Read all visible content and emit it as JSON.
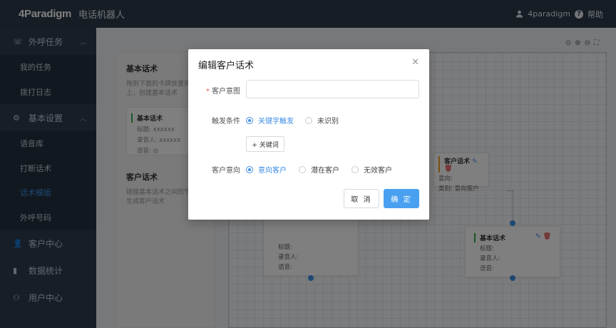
{
  "header": {
    "logo_prefix": "4",
    "logo_text": "Paradigm",
    "app_title": "电话机器人",
    "user_icon": "user-icon",
    "username": "4paradigm",
    "help_icon": "help-circle-icon",
    "help_label": "帮助"
  },
  "sidebar": {
    "groups": [
      {
        "label": "外呼任务",
        "icon": "phone-icon"
      },
      {
        "label": "基本设置",
        "icon": "gear-icon"
      },
      {
        "label": "客户中心",
        "icon": "user-icon"
      },
      {
        "label": "数据统计",
        "icon": "bar-chart-icon"
      },
      {
        "label": "用户中心",
        "icon": "user-outline-icon"
      }
    ],
    "task_items": [
      "我的任务",
      "拨打日志"
    ],
    "settings_items": [
      "语音库",
      "打断话术",
      "话术模版",
      "外呼号码"
    ],
    "active_item": "话术模版"
  },
  "left_panel": {
    "basic_title": "基本话术",
    "basic_desc": "拖到下面的卡牌放置到画布上，创建基本话术",
    "card_title": "基本话术",
    "card_rows": [
      "标题:",
      "录音人:",
      "语音:"
    ],
    "card_values": [
      "xxxxxx",
      "xxxxxx"
    ],
    "customer_title": "客户话术",
    "customer_desc": "链接基本话术之间的节点，生成客户话术"
  },
  "canvas": {
    "node_customer": {
      "title": "客户话术",
      "rows": [
        "意向:",
        "类别: 意向客户"
      ]
    },
    "node_basic": {
      "title": "基本话术",
      "rows": [
        "标题:",
        "录音人:",
        "语音:"
      ]
    },
    "node_left": {
      "rows": [
        "标题:",
        "录音人:",
        "语音:"
      ]
    }
  },
  "modal": {
    "title": "编辑客户话术",
    "close_icon": "close-icon",
    "intent_label": "客户意图",
    "intent_value": "",
    "intent_placeholder": "",
    "trigger_label": "触发条件",
    "trigger_options": [
      "关键字触发",
      "未识别"
    ],
    "trigger_selected": "关键字触发",
    "keyword_button": "+ 关键词",
    "direction_label": "客户意向",
    "direction_options": [
      "意向客户",
      "潜在客户",
      "无效客户"
    ],
    "direction_selected": "意向客户",
    "cancel_label": "取 消",
    "ok_label": "确 定"
  },
  "colors": {
    "topbar": "#2c3a4b",
    "sidebar": "#2f3d4e",
    "accent": "#3e8ee6",
    "primary_button": "#4aa0f0"
  }
}
